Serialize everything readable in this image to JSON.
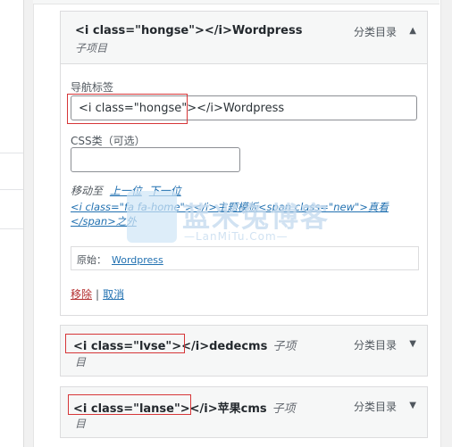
{
  "menu_items": [
    {
      "title": "<i class=\"hongse\"></i>Wordpress",
      "sub_label": "子项目",
      "type_label": "分类目录",
      "expanded": true
    },
    {
      "title": "<i class=\"lvse\"></i>dedecms",
      "sub_label_1": "子项",
      "sub_label_2": "目",
      "type_label": "分类目录",
      "expanded": false
    },
    {
      "title": "<i class=\"lanse\"></i>苹果cms",
      "sub_label_1": "子项",
      "sub_label_2": "目",
      "type_label": "分类目录",
      "expanded": false
    }
  ],
  "settings": {
    "nav_label": "导航标签",
    "nav_value": "<i class=\"hongse\"></i>Wordpress",
    "css_label": "CSS类（可选）",
    "css_value": "",
    "move_label": "移动至",
    "move_up": "上一位",
    "move_down": "下一位",
    "move_html": "<i class=\"fa fa-home\"></i>主题模板<span class=\"new\">真看</span>之外",
    "original_label": "原始：",
    "original_link": "Wordpress",
    "remove": "移除",
    "separator": "|",
    "cancel": "取消"
  },
  "icons": {
    "collapse": "▲",
    "expand": "▼"
  },
  "watermark": {
    "text": "蓝米兔博客",
    "sub": "—LanMiTu.Com—"
  },
  "colors": {
    "link": "#2271b1",
    "danger": "#b32d2e",
    "highlight_box": "#d63638"
  }
}
